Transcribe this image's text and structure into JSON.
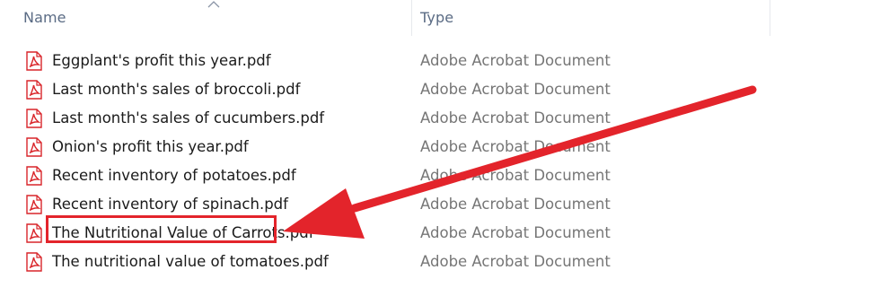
{
  "columns": {
    "name_label": "Name",
    "type_label": "Type"
  },
  "icons": {
    "sort": "sort-ascending-caret-icon",
    "file": "pdf-file-icon"
  },
  "colors": {
    "pdf_red": "#d9252a",
    "annotation_red": "#e3242b"
  },
  "files": [
    {
      "name": "Eggplant's profit this year.pdf",
      "type": "Adobe Acrobat Document"
    },
    {
      "name": "Last month's sales of broccoli.pdf",
      "type": "Adobe Acrobat Document"
    },
    {
      "name": "Last month's sales of cucumbers.pdf",
      "type": "Adobe Acrobat Document"
    },
    {
      "name": "Onion's profit this year.pdf",
      "type": "Adobe Acrobat Document"
    },
    {
      "name": "Recent inventory of potatoes.pdf",
      "type": "Adobe Acrobat Document"
    },
    {
      "name": "Recent inventory of spinach.pdf",
      "type": "Adobe Acrobat Document"
    },
    {
      "name": "The Nutritional Value of Carrots.pdf",
      "type": "Adobe Acrobat Document"
    },
    {
      "name": "The nutritional value of tomatoes.pdf",
      "type": "Adobe Acrobat Document"
    }
  ]
}
